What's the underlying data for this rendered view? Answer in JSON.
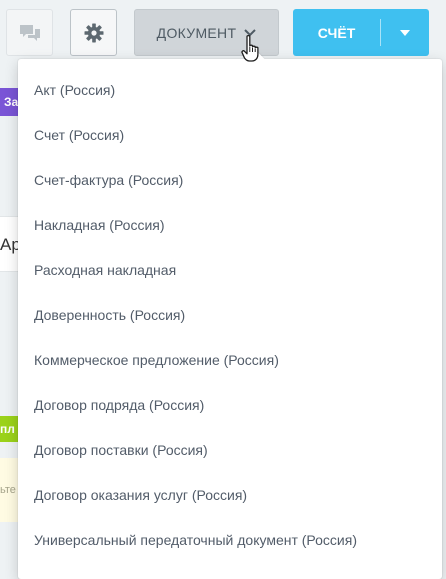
{
  "toolbar": {
    "document_label": "ДОКУМЕНТ",
    "invoice_label": "СЧЁТ",
    "accent_color": "#3fc0f0"
  },
  "background": {
    "purple_fragment": "За",
    "white_fragment": "Ар",
    "green_fragment": "пл",
    "yellow_fragment": "ьте"
  },
  "menu": {
    "items": [
      {
        "label": "Акт (Россия)"
      },
      {
        "label": "Счет (Россия)"
      },
      {
        "label": "Счет-фактура (Россия)"
      },
      {
        "label": "Накладная (Россия)"
      },
      {
        "label": "Расходная накладная"
      },
      {
        "label": "Доверенность (Россия)"
      },
      {
        "label": "Коммерческое предложение (Россия)"
      },
      {
        "label": "Договор подряда (Россия)"
      },
      {
        "label": "Договор поставки (Россия)"
      },
      {
        "label": "Договор оказания услуг (Россия)"
      },
      {
        "label": "Универсальный передаточный документ (Россия)"
      }
    ]
  }
}
